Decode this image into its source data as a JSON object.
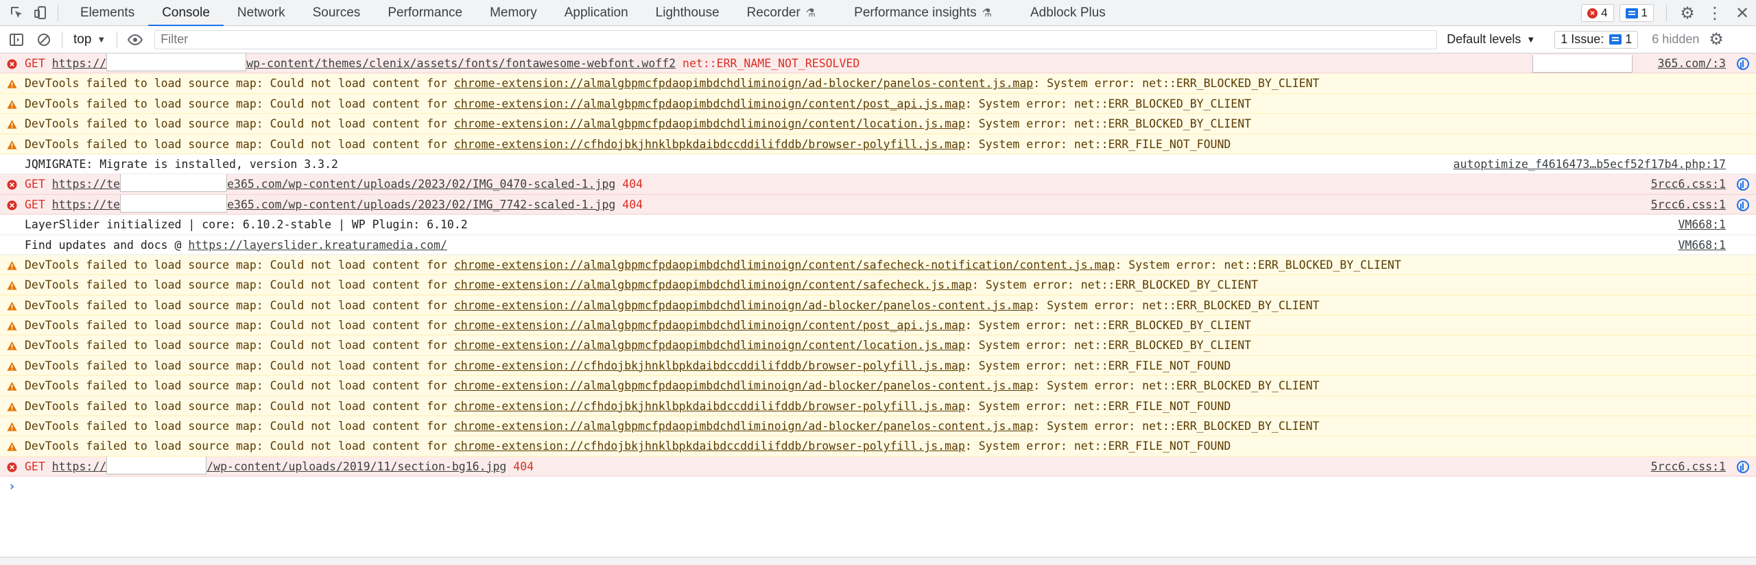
{
  "tabbar": {
    "tabs": [
      {
        "label": "Elements"
      },
      {
        "label": "Console"
      },
      {
        "label": "Network"
      },
      {
        "label": "Sources"
      },
      {
        "label": "Performance"
      },
      {
        "label": "Memory"
      },
      {
        "label": "Application"
      },
      {
        "label": "Lighthouse"
      },
      {
        "label": "Recorder"
      },
      {
        "label": "Performance insights"
      },
      {
        "label": "Adblock Plus"
      }
    ],
    "error_count": "4",
    "message_count": "1"
  },
  "toolbar": {
    "context": "top",
    "filter_placeholder": "Filter",
    "levels": "Default levels",
    "issues_label": "1 Issue:",
    "issues_count": "1",
    "hidden": "6 hidden"
  },
  "messages": [
    {
      "level": "error",
      "prefix": "GET ",
      "link_a": "https://",
      "link_b": "wp-content/themes/clenix/assets/fonts/fontawesome-webfont.woff2",
      "suffix": "net::ERR_NAME_NOT_RESOLVED",
      "source": "365.com/:3"
    },
    {
      "level": "warning",
      "prefix": "DevTools failed to load source map: Could not load content for ",
      "link": "chrome-extension://almalgbpmcfpdaopimbdchdliminoign/ad-blocker/panelos-content.js.map",
      "suffix": ": System error: net::ERR_BLOCKED_BY_CLIENT"
    },
    {
      "level": "warning",
      "prefix": "DevTools failed to load source map: Could not load content for ",
      "link": "chrome-extension://almalgbpmcfpdaopimbdchdliminoign/content/post_api.js.map",
      "suffix": ": System error: net::ERR_BLOCKED_BY_CLIENT"
    },
    {
      "level": "warning",
      "prefix": "DevTools failed to load source map: Could not load content for ",
      "link": "chrome-extension://almalgbpmcfpdaopimbdchdliminoign/content/location.js.map",
      "suffix": ": System error: net::ERR_BLOCKED_BY_CLIENT"
    },
    {
      "level": "warning",
      "prefix": "DevTools failed to load source map: Could not load content for ",
      "link": "chrome-extension://cfhdojbkjhnklbpkdaibdccddilifddb/browser-polyfill.js.map",
      "suffix": ": System error: net::ERR_FILE_NOT_FOUND"
    },
    {
      "level": "info",
      "text": "JQMIGRATE: Migrate is installed, version 3.3.2",
      "source": "autoptimize_f4616473…b5ecf52f17b4.php:17"
    },
    {
      "level": "error",
      "prefix": "GET ",
      "link_a": "https://te",
      "link_b": "e365.com/wp-content/uploads/2023/02/IMG_0470-scaled-1.jpg",
      "suffix": "404",
      "source": "5rcc6.css:1"
    },
    {
      "level": "error",
      "prefix": "GET ",
      "link_a": "https://te",
      "link_b": "e365.com/wp-content/uploads/2023/02/IMG_7742-scaled-1.jpg",
      "suffix": "404",
      "source": "5rcc6.css:1"
    },
    {
      "level": "info",
      "text": "LayerSlider initialized | core: 6.10.2-stable | WP Plugin: 6.10.2",
      "source": "VM668:1"
    },
    {
      "level": "info",
      "prefix": "Find updates and docs @ ",
      "link": "https://layerslider.kreaturamedia.com/",
      "source": "VM668:1"
    },
    {
      "level": "warning",
      "prefix": "DevTools failed to load source map: Could not load content for ",
      "link": "chrome-extension://almalgbpmcfpdaopimbdchdliminoign/content/safecheck-notification/content.js.map",
      "suffix": ": System error: net::ERR_BLOCKED_BY_CLIENT"
    },
    {
      "level": "warning",
      "prefix": "DevTools failed to load source map: Could not load content for ",
      "link": "chrome-extension://almalgbpmcfpdaopimbdchdliminoign/content/safecheck.js.map",
      "suffix": ": System error: net::ERR_BLOCKED_BY_CLIENT"
    },
    {
      "level": "warning",
      "prefix": "DevTools failed to load source map: Could not load content for ",
      "link": "chrome-extension://almalgbpmcfpdaopimbdchdliminoign/ad-blocker/panelos-content.js.map",
      "suffix": ": System error: net::ERR_BLOCKED_BY_CLIENT"
    },
    {
      "level": "warning",
      "prefix": "DevTools failed to load source map: Could not load content for ",
      "link": "chrome-extension://almalgbpmcfpdaopimbdchdliminoign/content/post_api.js.map",
      "suffix": ": System error: net::ERR_BLOCKED_BY_CLIENT"
    },
    {
      "level": "warning",
      "prefix": "DevTools failed to load source map: Could not load content for ",
      "link": "chrome-extension://almalgbpmcfpdaopimbdchdliminoign/content/location.js.map",
      "suffix": ": System error: net::ERR_BLOCKED_BY_CLIENT"
    },
    {
      "level": "warning",
      "prefix": "DevTools failed to load source map: Could not load content for ",
      "link": "chrome-extension://cfhdojbkjhnklbpkdaibdccddilifddb/browser-polyfill.js.map",
      "suffix": ": System error: net::ERR_FILE_NOT_FOUND"
    },
    {
      "level": "warning",
      "prefix": "DevTools failed to load source map: Could not load content for ",
      "link": "chrome-extension://almalgbpmcfpdaopimbdchdliminoign/ad-blocker/panelos-content.js.map",
      "suffix": ": System error: net::ERR_BLOCKED_BY_CLIENT"
    },
    {
      "level": "warning",
      "prefix": "DevTools failed to load source map: Could not load content for ",
      "link": "chrome-extension://cfhdojbkjhnklbpkdaibdccddilifddb/browser-polyfill.js.map",
      "suffix": ": System error: net::ERR_FILE_NOT_FOUND"
    },
    {
      "level": "warning",
      "prefix": "DevTools failed to load source map: Could not load content for ",
      "link": "chrome-extension://almalgbpmcfpdaopimbdchdliminoign/ad-blocker/panelos-content.js.map",
      "suffix": ": System error: net::ERR_BLOCKED_BY_CLIENT"
    },
    {
      "level": "warning",
      "prefix": "DevTools failed to load source map: Could not load content for ",
      "link": "chrome-extension://cfhdojbkjhnklbpkdaibdccddilifddb/browser-polyfill.js.map",
      "suffix": ": System error: net::ERR_FILE_NOT_FOUND"
    },
    {
      "level": "error",
      "prefix": "GET ",
      "link_a": "https://",
      "link_b": "/wp-content/uploads/2019/11/section-bg16.jpg",
      "suffix": "404",
      "source": "5rcc6.css:1"
    }
  ],
  "colors": {
    "accent": "#1a73e8",
    "error_text": "#d93025",
    "error_bg": "#fcebeb",
    "warning_bg": "#fffbe5",
    "warning_text": "#5c3b00"
  }
}
